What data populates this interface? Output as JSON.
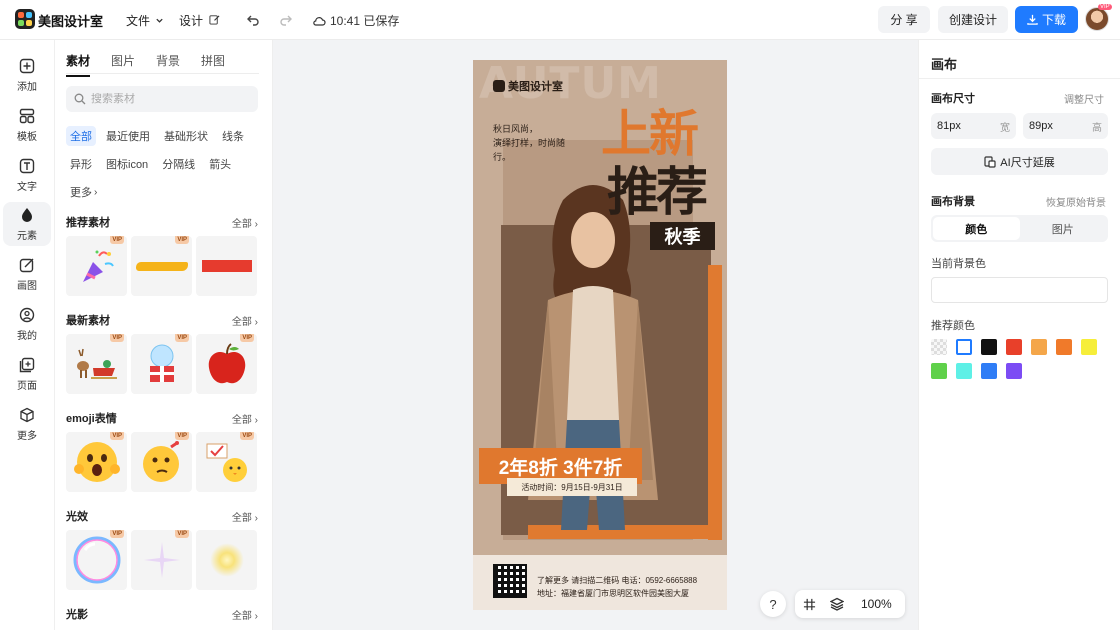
{
  "app": {
    "name": "美图设计室"
  },
  "topbar": {
    "menu_file": "文件",
    "menu_design": "设计",
    "save_status": "10:41 已保存",
    "share_label": "分 享",
    "create_label": "创建设计",
    "download_label": "下载",
    "avatar_badge": "VIP"
  },
  "rail": {
    "items": [
      {
        "label": "添加",
        "icon": "plus-square-icon"
      },
      {
        "label": "模板",
        "icon": "template-icon"
      },
      {
        "label": "文字",
        "icon": "text-icon"
      },
      {
        "label": "元素",
        "icon": "shapes-icon"
      },
      {
        "label": "画图",
        "icon": "draw-icon"
      },
      {
        "label": "我的",
        "icon": "user-icon"
      },
      {
        "label": "页面",
        "icon": "page-icon"
      },
      {
        "label": "更多",
        "icon": "cube-icon"
      }
    ]
  },
  "panel": {
    "tabs": [
      "素材",
      "图片",
      "背景",
      "拼图"
    ],
    "search_placeholder": "搜索素材",
    "chips": [
      "全部",
      "最近使用",
      "基础形状",
      "线条",
      "异形",
      "图标icon",
      "分隔线",
      "箭头",
      "更多"
    ],
    "view_all": "全部",
    "vip_badge": "VIP",
    "sections": [
      {
        "title": "推荐素材"
      },
      {
        "title": "最新素材"
      },
      {
        "title": "emoji表情"
      },
      {
        "title": "光效"
      },
      {
        "title": "光影"
      }
    ]
  },
  "poster": {
    "brand": "美图设计室",
    "watermark": "AUTUM",
    "slogan_line1": "秋日风尚，",
    "slogan_line2": "演绎打样，时尚随行。",
    "headline_top": "上新",
    "headline_main": "推荐",
    "season": "秋季",
    "sale": "2年8折 3件7折",
    "date": "活动时间：9月15日-9月31日",
    "info_line1": "了解更多 请扫描二维码    电话：0592-6665888",
    "info_line2": "地址：福建省厦门市思明区软件园美图大厦"
  },
  "zoom": {
    "help": "?",
    "value": "100%"
  },
  "props": {
    "title": "画布",
    "size_label": "画布尺寸",
    "size_action": "调整尺寸",
    "width_value": "81px",
    "width_unit": "宽",
    "height_value": "89px",
    "height_unit": "高",
    "ai_extend": "AI尺寸延展",
    "bg_label": "画布背景",
    "bg_reset": "恢复原始背景",
    "seg_color": "颜色",
    "seg_image": "图片",
    "current_bg": "当前背景色",
    "recommended": "推荐颜色",
    "swatches": [
      "transparent",
      "#ffffff",
      "#111111",
      "#e8402a",
      "#f4a64a",
      "#f07a2a",
      "#f6ee3a",
      "#5fd14a",
      "#5ef0e6",
      "#2f7df6",
      "#7c4cf4"
    ]
  },
  "colors": {
    "accent": "#1f7bff",
    "poster_orange": "#e0782e",
    "poster_dark": "#2a1e16"
  }
}
